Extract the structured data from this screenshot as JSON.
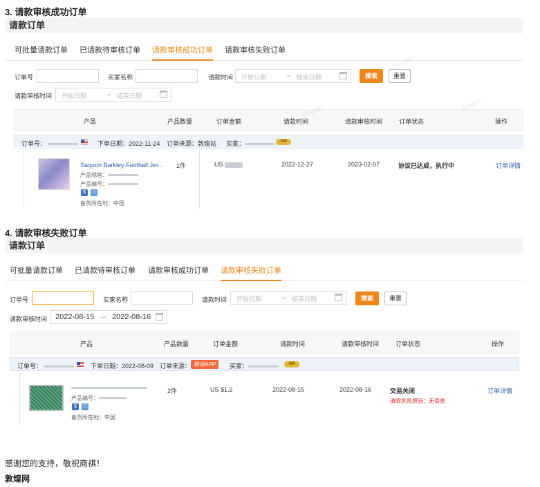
{
  "sections": [
    {
      "heading": "3. 请款审核成功订单",
      "panel_title": "请款订单",
      "tabs": [
        {
          "label": "可批量请款订单",
          "active": false
        },
        {
          "label": "已请款待审核订单",
          "active": false
        },
        {
          "label": "请款审核成功订单",
          "active": true
        },
        {
          "label": "请款审核失败订单",
          "active": false
        }
      ],
      "filters": {
        "order_no_label": "订单号",
        "buyer_label": "买家名称",
        "request_time_label": "请款时间",
        "request_start": "开始日期",
        "request_end": "结束日期",
        "search_label": "搜索",
        "reset_label": "重置",
        "review_time_label": "请款审核时间",
        "review_start": "开始日期",
        "review_end": "结束日期",
        "arrow": "→"
      },
      "columns": [
        "产品",
        "产品数量",
        "订单金额",
        "请款时间",
        "请款审核时间",
        "订单状态",
        "操作"
      ],
      "order": {
        "order_no_label": "订单号：",
        "order_date_label": "下单日期：",
        "order_date": "2022-11-24",
        "source_label": "订单来源：",
        "source": "敦煌站",
        "buyer_label": "买家：",
        "vip": "VIP",
        "product_name": "Saquon Barkley Football Jer...",
        "spec_label": "产品规格：",
        "code_label": "产品编号：",
        "location": "备货所在地：中国",
        "quantity": "1件",
        "amount": "US",
        "request_time": "2022-12-27",
        "review_time": "2023-02-07",
        "status": "协议已达成，执行中",
        "action": "订单详情",
        "badge1": "$",
        "badge2": "⬡"
      }
    },
    {
      "heading": "4. 请款审核失败订单",
      "panel_title": "请款订单",
      "tabs": [
        {
          "label": "可批量请款订单",
          "active": false
        },
        {
          "label": "已请款待审核订单",
          "active": false
        },
        {
          "label": "请款审核成功订单",
          "active": false
        },
        {
          "label": "请款审核失败订单",
          "active": true
        }
      ],
      "filters": {
        "order_no_label": "订单号",
        "buyer_label": "买家名称",
        "request_time_label": "请款时间",
        "request_start": "开始日期",
        "request_end": "结束日期",
        "search_label": "搜索",
        "reset_label": "重置",
        "review_time_label": "请款审核时间",
        "review_start": "2022-08-15",
        "review_end": "2022-08-16",
        "arrow": "→"
      },
      "columns": [
        "产品",
        "产品数量",
        "订单金额",
        "请款时间",
        "请款审核时间",
        "订单状态",
        "操作"
      ],
      "order": {
        "order_no_label": "订单号：",
        "order_date_label": "下单日期：",
        "order_date": "2022-08-09",
        "source_label": "订单来源：",
        "source": "移动APP",
        "buyer_label": "买家：",
        "vip": "VIP",
        "code_label": "产品编号：",
        "location": "备货所在地：中国",
        "quantity": "2件",
        "amount": "US $1.2",
        "request_time": "2022-08-15",
        "review_time": "2022-08-16",
        "status": "交易关闭",
        "fail_reason": "请款失败原因：无信息",
        "action": "订单详情",
        "badge1": "$",
        "badge2": "⬡"
      }
    }
  ],
  "footer": {
    "thanks": "感谢您的支持，敬祝商祺！",
    "brand": "敦煌网"
  },
  "colors": {
    "accent": "#f08519",
    "link": "#2a5db0",
    "error": "#e02020"
  }
}
